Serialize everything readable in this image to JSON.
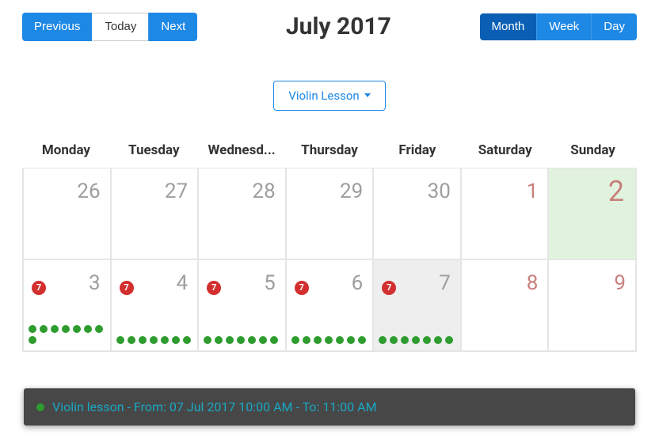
{
  "toolbar": {
    "prev": "Previous",
    "today": "Today",
    "next": "Next",
    "title": "July 2017",
    "view_month": "Month",
    "view_week": "Week",
    "view_day": "Day"
  },
  "dropdown": {
    "label": "Violin Lesson"
  },
  "days": [
    "Monday",
    "Tuesday",
    "Wednesd...",
    "Thursday",
    "Friday",
    "Saturday",
    "Sunday"
  ],
  "row1": [
    {
      "n": "26",
      "muted": true
    },
    {
      "n": "27",
      "muted": true
    },
    {
      "n": "28",
      "muted": true
    },
    {
      "n": "29",
      "muted": true
    },
    {
      "n": "30",
      "muted": true
    },
    {
      "n": "1",
      "red": true
    },
    {
      "n": "2",
      "bigred": true,
      "green": true
    }
  ],
  "row2": [
    {
      "n": "3",
      "badge": "7",
      "dots": 8
    },
    {
      "n": "4",
      "badge": "7",
      "dots": 7
    },
    {
      "n": "5",
      "badge": "7",
      "dots": 7
    },
    {
      "n": "6",
      "badge": "7",
      "dots": 7
    },
    {
      "n": "7",
      "badge": "7",
      "dots": 7,
      "gray": true
    },
    {
      "n": "8",
      "red": true
    },
    {
      "n": "9",
      "red": true
    }
  ],
  "tooltip": {
    "text": "Violin lesson - From: 07 Jul 2017 10:00 AM - To: 11:00 AM"
  }
}
